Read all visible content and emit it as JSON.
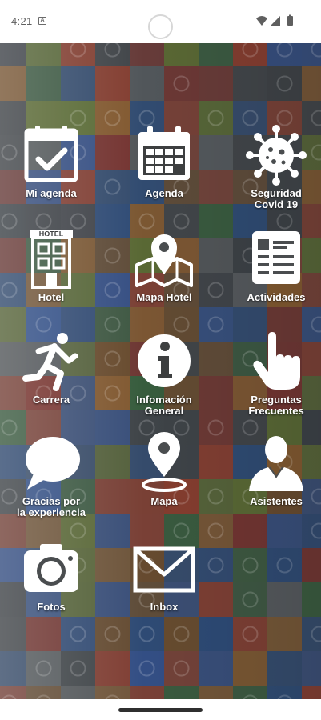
{
  "status_bar": {
    "time": "4:21",
    "notification_icon": "a-box-icon",
    "icons": [
      "wifi-icon",
      "signal-icon",
      "battery-icon"
    ]
  },
  "background": {
    "tile_colors": [
      "#8b3b2c",
      "#2f4f8f",
      "#5c6f2e",
      "#6b4a2a",
      "#3a3f45",
      "#355e3b",
      "#7a2f2a",
      "#2a4a7a",
      "#555a5e",
      "#8a5a2a"
    ]
  },
  "menu": [
    {
      "label": "Mi agenda",
      "icon": "calendar-check-icon"
    },
    {
      "label": "Agenda",
      "icon": "calendar-grid-icon"
    },
    {
      "label": "Seguridad\nCovid 19",
      "icon": "virus-icon"
    },
    {
      "label": "Hotel",
      "icon": "hotel-building-icon"
    },
    {
      "label": "Mapa Hotel",
      "icon": "map-pin-icon"
    },
    {
      "label": "Actividades",
      "icon": "list-card-icon"
    },
    {
      "label": "Carrera",
      "icon": "runner-icon"
    },
    {
      "label": "Infomación\nGeneral",
      "icon": "info-circle-icon"
    },
    {
      "label": "Preguntas\nFrecuentes",
      "icon": "pointing-hand-icon"
    },
    {
      "label": "Gracias por\nla experiencia",
      "icon": "speech-bubble-icon"
    },
    {
      "label": "Mapa",
      "icon": "location-pin-icon"
    },
    {
      "label": "Asistentes",
      "icon": "person-icon"
    },
    {
      "label": "Fotos",
      "icon": "camera-icon"
    },
    {
      "label": "Inbox",
      "icon": "envelope-icon"
    }
  ]
}
